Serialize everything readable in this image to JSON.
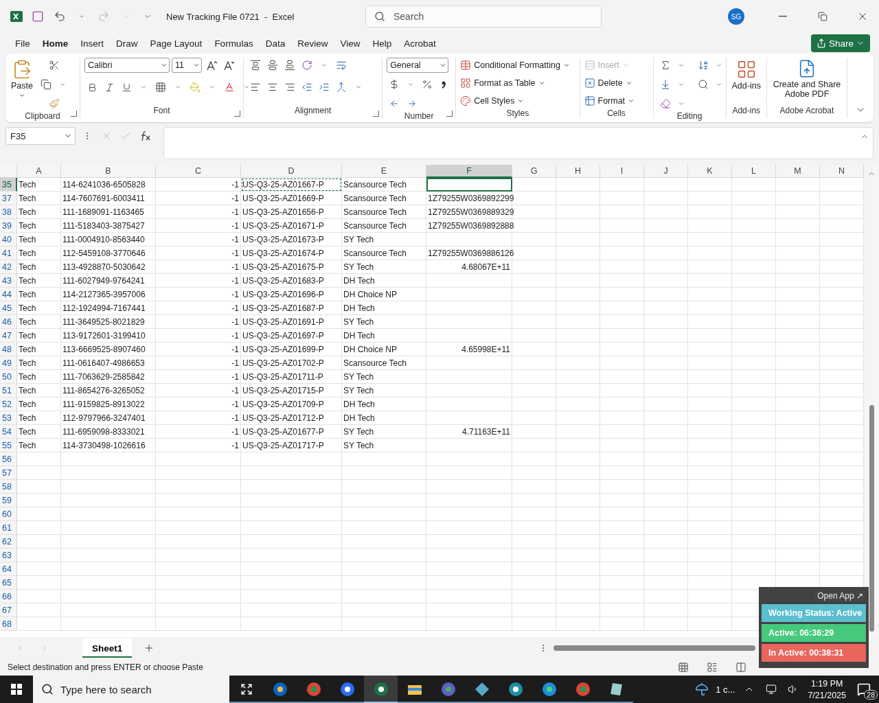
{
  "window": {
    "title": "New Tracking File 0721  -  Excel",
    "search_placeholder": "Search",
    "avatar": "SG"
  },
  "menu": {
    "tabs": [
      {
        "label": "File",
        "selected": false
      },
      {
        "label": "Home",
        "selected": true
      },
      {
        "label": "Insert",
        "selected": false
      },
      {
        "label": "Draw",
        "selected": false
      },
      {
        "label": "Page Layout",
        "selected": false
      },
      {
        "label": "Formulas",
        "selected": false
      },
      {
        "label": "Data",
        "selected": false
      },
      {
        "label": "Review",
        "selected": false
      },
      {
        "label": "View",
        "selected": false
      },
      {
        "label": "Help",
        "selected": false
      },
      {
        "label": "Acrobat",
        "selected": false
      }
    ],
    "share": "Share"
  },
  "ribbon": {
    "paste": "Paste",
    "font_name": "Calibri",
    "font_size": "11",
    "number_format": "General",
    "styles": [
      "Conditional Formatting",
      "Format as Table",
      "Cell Styles"
    ],
    "cells": [
      {
        "label": "Insert",
        "disabled": true
      },
      {
        "label": "Delete",
        "disabled": false
      },
      {
        "label": "Format",
        "disabled": false
      }
    ],
    "addins": "Add-ins",
    "acrobat": "Create and Share Adobe PDF",
    "groups": [
      "Clipboard",
      "Font",
      "Alignment",
      "Number",
      "Styles",
      "Cells",
      "Editing",
      "Add-ins",
      "Adobe Acrobat"
    ]
  },
  "formula_bar": {
    "name_box": "F35"
  },
  "sheet": {
    "columns": [
      {
        "label": "A",
        "selected": false,
        "copied": false
      },
      {
        "label": "B",
        "selected": false,
        "copied": false
      },
      {
        "label": "C",
        "selected": false,
        "copied": false,
        "kind": "number"
      },
      {
        "label": "D",
        "selected": false,
        "copied": true
      },
      {
        "label": "E",
        "selected": false,
        "copied": false
      },
      {
        "label": "F",
        "selected": true,
        "copied": false
      },
      {
        "label": "G",
        "selected": false,
        "copied": false
      },
      {
        "label": "H",
        "selected": false,
        "copied": false
      },
      {
        "label": "I",
        "selected": false,
        "copied": false
      },
      {
        "label": "J",
        "selected": false,
        "copied": false
      },
      {
        "label": "K",
        "selected": false,
        "copied": false
      },
      {
        "label": "L",
        "selected": false,
        "copied": false
      },
      {
        "label": "M",
        "selected": false,
        "copied": false
      },
      {
        "label": "N",
        "selected": false,
        "copied": false
      }
    ],
    "rows": [
      {
        "header": "35",
        "selected": true,
        "cells": [
          "Tech",
          "114-6241036-6505828",
          "-1",
          "US-Q3-25-AZ01667-P",
          "Scansource Tech"
        ]
      },
      {
        "header": "37",
        "selected": false,
        "cells": [
          "Tech",
          "114-7607691-6003411",
          "-1",
          "US-Q3-25-AZ01669-P",
          "Scansource Tech",
          "1Z79255W0369892299"
        ]
      },
      {
        "header": "38",
        "selected": false,
        "cells": [
          "Tech",
          "111-1689091-1163465",
          "-1",
          "US-Q3-25-AZ01656-P",
          "Scansource Tech",
          "1Z79255W0369889329"
        ]
      },
      {
        "header": "39",
        "selected": false,
        "cells": [
          "Tech",
          "111-5183403-3875427",
          "-1",
          "US-Q3-25-AZ01671-P",
          "Scansource Tech",
          "1Z79255W0369892888"
        ]
      },
      {
        "header": "40",
        "selected": false,
        "cells": [
          "Tech",
          "111-0004910-8563440",
          "-1",
          "US-Q3-25-AZ01673-P",
          "SY Tech"
        ]
      },
      {
        "header": "41",
        "selected": false,
        "cells": [
          "Tech",
          "112-5459108-3770646",
          "-1",
          "US-Q3-25-AZ01674-P",
          "Scansource Tech",
          "1Z79255W0369886126"
        ]
      },
      {
        "header": "42",
        "selected": false,
        "cells": [
          "Tech",
          "113-4928870-5030642",
          "-1",
          "US-Q3-25-AZ01675-P",
          "SY Tech",
          {
            "text": "4.68067E+11",
            "kind": "number"
          }
        ]
      },
      {
        "header": "43",
        "selected": false,
        "cells": [
          "Tech",
          "111-6027949-9764241",
          "-1",
          "US-Q3-25-AZ01683-P",
          "DH Tech"
        ]
      },
      {
        "header": "44",
        "selected": false,
        "cells": [
          "Tech",
          "114-2127365-3957006",
          "-1",
          "US-Q3-25-AZ01696-P",
          "DH Choice NP"
        ]
      },
      {
        "header": "45",
        "selected": false,
        "cells": [
          "Tech",
          "112-1924994-7167441",
          "-1",
          "US-Q3-25-AZ01687-P",
          "DH Tech"
        ]
      },
      {
        "header": "46",
        "selected": false,
        "cells": [
          "Tech",
          "111-3649525-8021829",
          "-1",
          "US-Q3-25-AZ01691-P",
          "SY Tech"
        ]
      },
      {
        "header": "47",
        "selected": false,
        "cells": [
          "Tech",
          "113-9172601-3199410",
          "-1",
          "US-Q3-25-AZ01697-P",
          "DH Tech"
        ]
      },
      {
        "header": "48",
        "selected": false,
        "cells": [
          "Tech",
          "113-6669525-8907460",
          "-1",
          "US-Q3-25-AZ01699-P",
          "DH Choice NP",
          {
            "text": "4.65998E+11",
            "kind": "number"
          }
        ]
      },
      {
        "header": "49",
        "selected": false,
        "cells": [
          "Tech",
          "111-0616407-4986653",
          "-1",
          "US-Q3-25-AZ01702-P",
          "Scansource Tech"
        ]
      },
      {
        "header": "50",
        "selected": false,
        "cells": [
          "Tech",
          "111-7063629-2585842",
          "-1",
          "US-Q3-25-AZ01711-P",
          "SY Tech"
        ]
      },
      {
        "header": "51",
        "selected": false,
        "cells": [
          "Tech",
          "111-8654276-3265052",
          "-1",
          "US-Q3-25-AZ01715-P",
          "SY Tech"
        ]
      },
      {
        "header": "52",
        "selected": false,
        "cells": [
          "Tech",
          "111-9159825-8913022",
          "-1",
          "US-Q3-25-AZ01709-P",
          "DH Tech"
        ]
      },
      {
        "header": "53",
        "selected": false,
        "cells": [
          "Tech",
          "112-9797966-3247401",
          "-1",
          "US-Q3-25-AZ01712-P",
          "DH Tech"
        ]
      },
      {
        "header": "54",
        "selected": false,
        "cells": [
          "Tech",
          "111-6959098-8333021",
          "-1",
          "US-Q3-25-AZ01677-P",
          "SY Tech",
          {
            "text": "4.71163E+11",
            "kind": "number"
          }
        ]
      },
      {
        "header": "55",
        "selected": false,
        "cells": [
          "Tech",
          "114-3730498-1026616",
          "-1",
          "US-Q3-25-AZ01717-P",
          "SY Tech"
        ]
      },
      {
        "header": "56",
        "selected": false
      },
      {
        "header": "57",
        "selected": false
      },
      {
        "header": "58",
        "selected": false
      },
      {
        "header": "59",
        "selected": false
      },
      {
        "header": "60",
        "selected": false
      },
      {
        "header": "61",
        "selected": false
      },
      {
        "header": "62",
        "selected": false
      },
      {
        "header": "63",
        "selected": false
      },
      {
        "header": "64",
        "selected": false
      },
      {
        "header": "65",
        "selected": false
      },
      {
        "header": "66",
        "selected": false
      },
      {
        "header": "67",
        "selected": false
      },
      {
        "header": "68",
        "selected": false
      }
    ],
    "tabs": [
      {
        "label": "Sheet1",
        "selected": true
      }
    ]
  },
  "status_bar": {
    "message": "Select destination and press ENTER or choose Paste"
  },
  "time_tracker": {
    "link": "Open App ↗",
    "statuses": [
      {
        "text": "Working Status: Active",
        "color": "#5bbfcf"
      },
      {
        "text": "Active: 06:36:29",
        "color": "#46c97c"
      },
      {
        "text": "In Active: 00:38:31",
        "color": "#e8665c"
      }
    ]
  },
  "taskbar": {
    "search_placeholder": "Type here to search",
    "apps": [
      {
        "kind": "mail",
        "selected": false
      },
      {
        "kind": "browser",
        "selected": false
      },
      {
        "kind": "meeting",
        "selected": false
      },
      {
        "kind": "spreadsheet",
        "selected": true
      },
      {
        "kind": "folder",
        "selected": false
      },
      {
        "kind": "chat",
        "selected": false
      },
      {
        "kind": "diamond",
        "selected": false
      },
      {
        "kind": "vpn",
        "selected": false
      },
      {
        "kind": "edge",
        "selected": false
      },
      {
        "kind": "browser",
        "selected": false
      },
      {
        "kind": "notes",
        "selected": false
      }
    ],
    "weather": "1 c...",
    "time": "1:19 PM",
    "date": "7/21/2025",
    "notifications": "28"
  }
}
